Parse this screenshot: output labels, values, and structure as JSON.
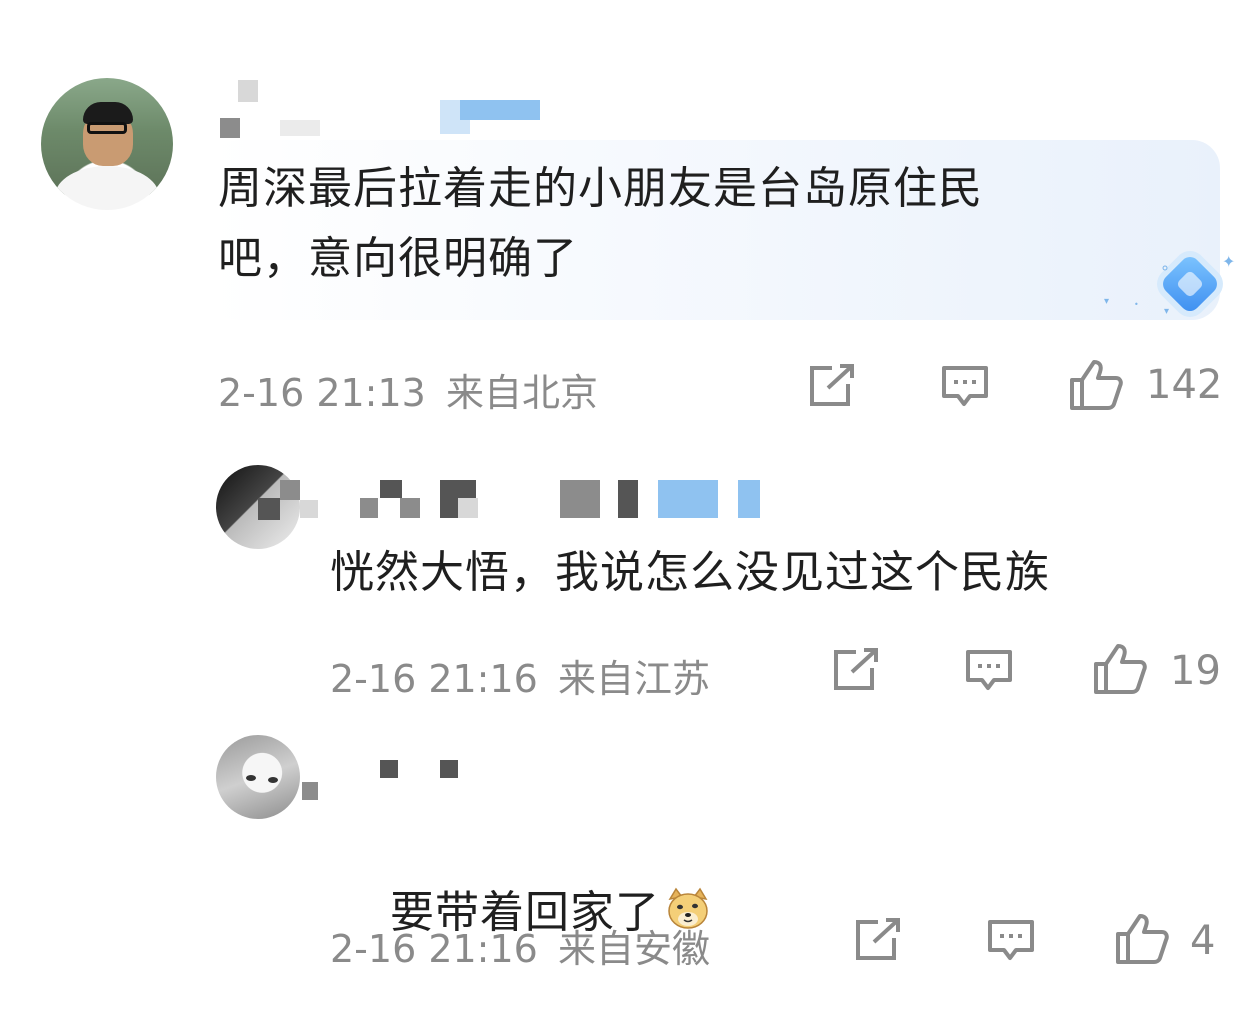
{
  "comments": [
    {
      "text": "周深最后拉着走的小朋友是台岛原住民\n吧，意向很明确了",
      "time": "2-16 21:13",
      "location": "来自北京",
      "likes": "142",
      "icons": {
        "forward": "share-icon",
        "reply": "comment-icon",
        "like": "thumbs-up-icon"
      }
    },
    {
      "text": "恍然大悟，我说怎么没见过这个民族",
      "time": "2-16 21:16",
      "location": "来自江苏",
      "likes": "19",
      "icons": {
        "forward": "share-icon",
        "reply": "comment-icon",
        "like": "thumbs-up-icon"
      }
    },
    {
      "text": "要带着回家了",
      "emoji": "doge-emoji",
      "time": "2-16 21:16",
      "location": "来自安徽",
      "likes": "4",
      "icons": {
        "forward": "share-icon",
        "reply": "comment-icon",
        "like": "thumbs-up-icon"
      }
    }
  ],
  "colors": {
    "text": "#1f1f1f",
    "meta": "#8a8a8a",
    "highlight": "#e9f1fb",
    "accent": "#3c8df0"
  }
}
